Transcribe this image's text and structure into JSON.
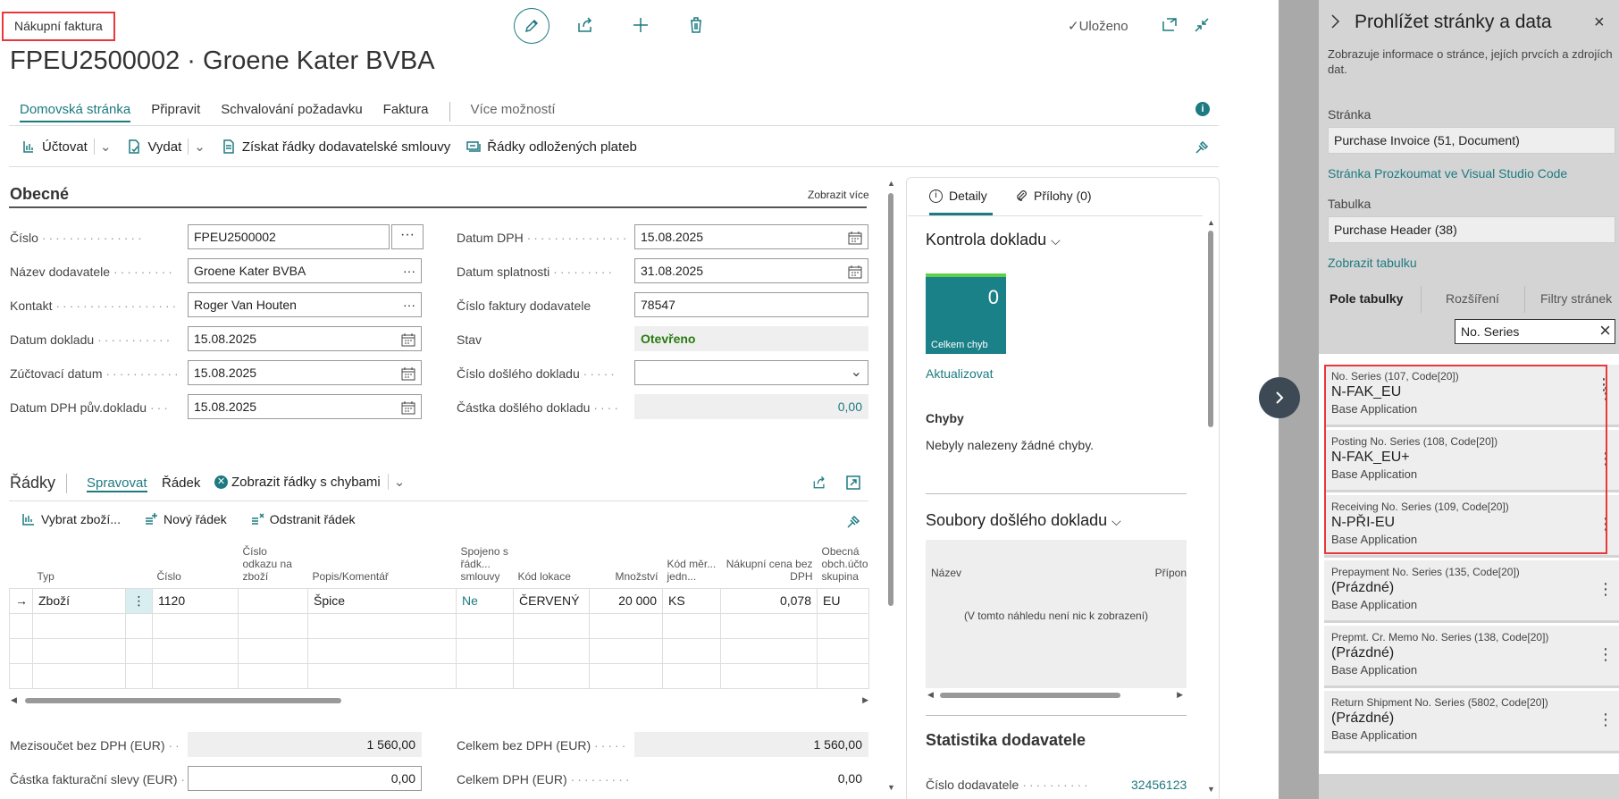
{
  "header": {
    "badge": "Nákupní faktura",
    "title": "FPEU2500002 · Groene Kater BVBA",
    "status": "Uloženo"
  },
  "tabs": [
    "Domovská stránka",
    "Připravit",
    "Schvalování požadavku",
    "Faktura",
    "Více možností"
  ],
  "actions": [
    "Účtovat",
    "Vydat",
    "Získat řádky dodavatelské smlouvy",
    "Řádky odložených plateb"
  ],
  "general": {
    "title": "Obecné",
    "show_more": "Zobrazit více",
    "left": [
      {
        "label": "Číslo",
        "value": "FPEU2500002"
      },
      {
        "label": "Název dodavatele",
        "value": "Groene Kater BVBA"
      },
      {
        "label": "Kontakt",
        "value": "Roger Van Houten"
      },
      {
        "label": "Datum dokladu",
        "value": "15.08.2025"
      },
      {
        "label": "Zúčtovací datum",
        "value": "15.08.2025"
      },
      {
        "label": "Datum DPH pův.dokladu",
        "value": "15.08.2025"
      }
    ],
    "right": [
      {
        "label": "Datum DPH",
        "value": "15.08.2025"
      },
      {
        "label": "Datum splatnosti",
        "value": "31.08.2025"
      },
      {
        "label": "Číslo faktury dodavatele",
        "value": "78547"
      },
      {
        "label": "Stav",
        "value": "Otevřeno"
      },
      {
        "label": "Číslo došlého dokladu",
        "value": ""
      },
      {
        "label": "Částka došlého dokladu",
        "value": "0,00"
      }
    ]
  },
  "lines": {
    "title": "Řádky",
    "tabs": [
      "Spravovat",
      "Řádek",
      "Zobrazit řádky s chybami"
    ],
    "actions": [
      "Vybrat zboží...",
      "Nový řádek",
      "Odstranit řádek"
    ],
    "columns": [
      "Typ",
      "Číslo",
      "Číslo odkazu na zboží",
      "Popis/Komentář",
      "Spojeno s řádk... smlouvy",
      "Kód lokace",
      "Množství",
      "Kód měr... jedn...",
      "Nákupní cena bez DPH",
      "Obecná obch.účto skupina"
    ],
    "rows": [
      [
        "Zboží",
        "1120",
        "",
        "Špice",
        "Ne",
        "ČERVENÝ",
        "20 000",
        "KS",
        "0,078",
        "EU"
      ]
    ]
  },
  "totals": [
    {
      "label": "Mezisoučet bez DPH (EUR)",
      "value": "1 560,00"
    },
    {
      "label": "Částka fakturační slevy (EUR)",
      "value": "0,00"
    },
    {
      "label": "Celkem bez DPH (EUR)",
      "value": "1 560,00"
    },
    {
      "label": "Celkem DPH (EUR)",
      "value": "0,00"
    }
  ],
  "factbox": {
    "tabs": [
      "Detaily",
      "Přílohy (0)"
    ],
    "check_title": "Kontrola dokladu",
    "tile_value": "0",
    "tile_label": "Celkem chyb",
    "refresh": "Aktualizovat",
    "errors_title": "Chyby",
    "errors_text": "Nebyly nalezeny žádné chyby.",
    "files_title": "Soubory došlého dokladu",
    "col_name": "Název",
    "col_ext": "Přípon",
    "empty_text": "(V tomto náhledu není nic k zobrazení)",
    "stats_title": "Statistika dodavatele",
    "vendor_no_label": "Číslo dodavatele",
    "vendor_no": "32456123"
  },
  "panel": {
    "title": "Prohlížet stránky a data",
    "desc": "Zobrazuje informace o stránce, jejích prvcích a zdrojích dat.",
    "page_label": "Stránka",
    "page_value": "Purchase Invoice (51, Document)",
    "vs_link": "Stránka Prozkoumat ve Visual Studio Code",
    "table_label": "Tabulka",
    "table_value": "Purchase Header (38)",
    "show_table": "Zobrazit tabulku",
    "tabs": [
      "Pole tabulky",
      "Rozšíření",
      "Filtry stránek"
    ],
    "filter": "No. Series",
    "fields": [
      {
        "name": "No. Series (107, Code[20])",
        "value": "N-FAK_EU",
        "app": "Base Application"
      },
      {
        "name": "Posting No. Series (108, Code[20])",
        "value": "N-FAK_EU+",
        "app": "Base Application"
      },
      {
        "name": "Receiving No. Series (109, Code[20])",
        "value": "N-PŘI-EU",
        "app": "Base Application"
      },
      {
        "name": "Prepayment No. Series (135, Code[20])",
        "value": "(Prázdné)",
        "app": "Base Application"
      },
      {
        "name": "Prepmt. Cr. Memo No. Series (138, Code[20])",
        "value": "(Prázdné)",
        "app": "Base Application"
      },
      {
        "name": "Return Shipment No. Series (5802, Code[20])",
        "value": "(Prázdné)",
        "app": "Base Application"
      }
    ]
  },
  "colors": {
    "accent": "#1d7a80",
    "highlight": "#e8383b",
    "tile": "#1b8188"
  }
}
